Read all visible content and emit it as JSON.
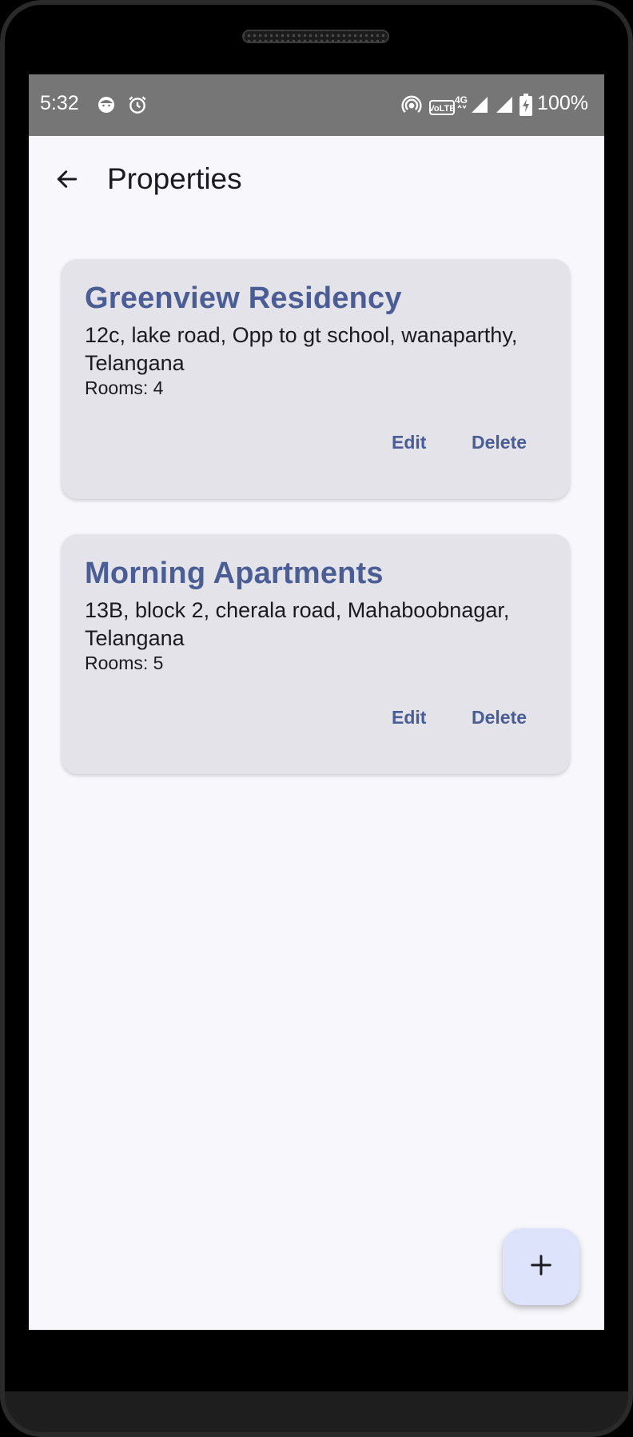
{
  "status_bar": {
    "time": "5:32",
    "icons": [
      "face-notification-icon",
      "alarm-icon",
      "hotspot-icon",
      "volte-icon",
      "signal-icon",
      "signal-icon",
      "battery-charging-icon"
    ],
    "volte_label": "VoLTE",
    "network_label": "4G",
    "battery": "100%"
  },
  "app_bar": {
    "title": "Properties",
    "back_icon": "arrow-left-icon"
  },
  "properties": [
    {
      "name": "Greenview Residency",
      "address": "12c, lake road, Opp to gt school, wanaparthy, Telangana",
      "rooms": "Rooms: 4",
      "edit_label": "Edit",
      "delete_label": "Delete"
    },
    {
      "name": "Morning Apartments",
      "address": "13B, block 2, cherala road, Mahaboobnagar, Telangana",
      "rooms": "Rooms: 5",
      "edit_label": "Edit",
      "delete_label": "Delete"
    }
  ],
  "fab": {
    "icon": "plus-icon"
  },
  "colors": {
    "accent": "#4a5d94",
    "card_bg": "#e3e3e9",
    "screen_bg": "#f7f7fc",
    "fab_bg": "#dde3fb",
    "status_bar": "#767676"
  }
}
